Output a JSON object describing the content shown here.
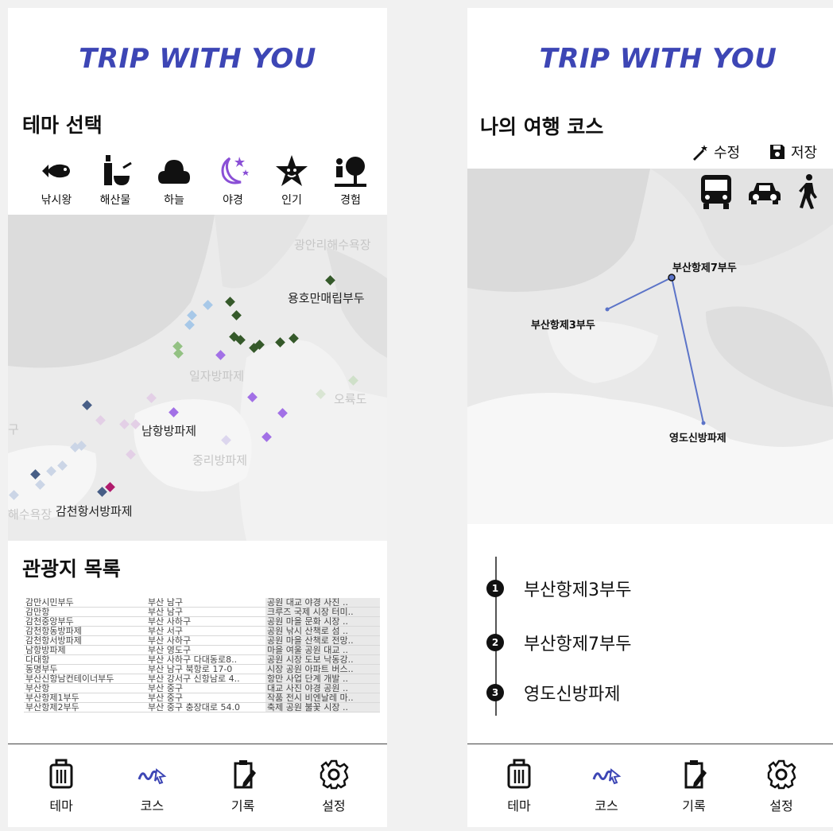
{
  "colors": {
    "brand": "#3d46b5",
    "accent": "#8a4fd6",
    "route": "#5c74c8",
    "fishing": "#35592a",
    "seafood": "#93c183",
    "sky": "#a7c8e8",
    "night": "#a270e6",
    "popular": "#cfc8e8",
    "experience": "#475e86",
    "highlight": "#b01a6c"
  },
  "left": {
    "brand": "TRIP WITH YOU",
    "theme_title": "테마 선택",
    "themes": [
      {
        "label": "낚시왕",
        "icon": "fish-icon"
      },
      {
        "label": "해산물",
        "icon": "bottle-bowl-icon"
      },
      {
        "label": "하늘",
        "icon": "cloud-icon"
      },
      {
        "label": "야경",
        "icon": "moon-stars-icon"
      },
      {
        "label": "인기",
        "icon": "star-icon"
      },
      {
        "label": "경험",
        "icon": "person-tree-icon"
      }
    ],
    "map_labels": {
      "gwangalli": "광안리해수욕장",
      "yongho": "용호만매립부두",
      "ilja": "일자방파제",
      "oryukdo": "오륙도",
      "gu": "구",
      "namhang": "남항방파제",
      "jungri": "중리방파제",
      "haesu": "해수욕장",
      "gamcheon": "감천항서방파제"
    },
    "list_title": "관광지 목록",
    "table_rows": [
      [
        "감만시민부두",
        "부산 남구",
        "공원 대교 야경 사진 .."
      ],
      [
        "감만항",
        "부산 남구",
        "크루즈 국제 시장 터미.."
      ],
      [
        "감천중앙부두",
        "부산 사하구",
        "공원 마을 문화 시장 .."
      ],
      [
        "감천항동방파제",
        "부산 서구",
        "공원 낚시 산책로 섬 .."
      ],
      [
        "감천항서방파제",
        "부산 사하구",
        "공원 마을 산책로 전망.."
      ],
      [
        "남항방파제",
        "부산 영도구",
        "마을 여울 공원 대교 .."
      ],
      [
        "다대항",
        "부산 사하구 다대동로8..",
        "공원 시장 도보 낙동강.."
      ],
      [
        "동명부두",
        "부산 남구 북항로 17-0",
        "시장 공원 아파트 버스.."
      ],
      [
        "부산신항남컨테이너부두",
        "부산 강서구 신항남로 4..",
        "항만 사업 단계 개발 .."
      ],
      [
        "부산항",
        "부산 중구",
        "대교 사진 야경 공원 .."
      ],
      [
        "부산항제1부두",
        "부산 중구",
        "작품 전시 비엔날레 마.."
      ],
      [
        "부산항제2부두",
        "부산 중구 충장대로 54.0",
        "축제 공원 불꽃 시장 .."
      ]
    ]
  },
  "right": {
    "brand": "TRIP WITH YOU",
    "course_title": "나의 여행 코스",
    "edit_label": "수정",
    "save_label": "저장",
    "map_labels": {
      "pier7": "부산항제7부두",
      "pier3": "부산항제3부두",
      "yeongdo": "영도신방파제"
    },
    "course": [
      {
        "num": "1",
        "name": "부산항제3부두"
      },
      {
        "num": "2",
        "name": "부산항제7부두"
      },
      {
        "num": "3",
        "name": "영도신방파제"
      }
    ]
  },
  "nav": [
    {
      "label": "테마",
      "icon": "suitcase-icon"
    },
    {
      "label": "코스",
      "icon": "route-icon"
    },
    {
      "label": "기록",
      "icon": "clipboard-pen-icon"
    },
    {
      "label": "설정",
      "icon": "gear-icon"
    }
  ]
}
